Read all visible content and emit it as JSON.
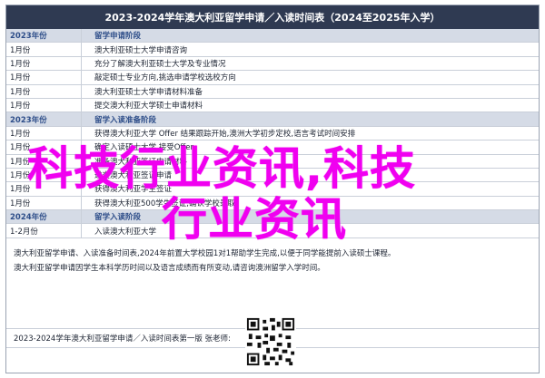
{
  "doc": {
    "title": "2023-2024学年澳大利亚留学申请／入读时间表（2024至2025年入学）"
  },
  "schedule": {
    "rows": [
      {
        "type": "section",
        "month": "2023年份",
        "event": "留学申请阶段"
      },
      {
        "type": "row",
        "month": "1月份",
        "event": "澳大利亚硕士大学申请咨询"
      },
      {
        "type": "row",
        "month": "1月份",
        "event": "充分了解澳大利亚硕士大学及专业情况"
      },
      {
        "type": "row",
        "month": "1月份",
        "event": "敲定硕士专业方向,挑选申请学校选校方向"
      },
      {
        "type": "row",
        "month": "1月份",
        "event": "澳大利亚硕士大学申请材料准备"
      },
      {
        "type": "row",
        "month": "1月份",
        "event": "提交澳大利亚大学硕士申请材料"
      },
      {
        "type": "section",
        "month": "2023年份",
        "event": "留学入读准备阶段"
      },
      {
        "type": "row",
        "month": "1月份",
        "event": "获得澳大利亚大学 Offer 结果跟踪开始,澳洲大学初步定校,语言考试时间安排"
      },
      {
        "type": "row",
        "month": "1月份",
        "event": "确定入读硕士大学,接受Offer"
      },
      {
        "type": "row",
        "month": "1月份",
        "event": "准备澳大利亚签证申请材料"
      },
      {
        "type": "row",
        "month": "1月份",
        "event": "递交澳大利亚签证申请"
      },
      {
        "type": "row",
        "month": "1月份",
        "event": "获得澳大利亚学生签证"
      },
      {
        "type": "row",
        "month": "1月份",
        "event": "获得澳大利亚500学生签证,确认学校录取"
      },
      {
        "type": "section",
        "month": "2024年份",
        "event": "留学入读阶段"
      },
      {
        "type": "row",
        "month": "1-2月份",
        "event": "入读澳大利亚大学"
      }
    ]
  },
  "notes": [
    "澳大利亚留学申请、入读准备时间表,2024年前置大学校园1对1帮助学生完成,以便于同学能提前入读硕士课程。",
    "澳大利亚留学申请因学生本科学历时间以及语言成绩而有所变动,请咨询澳洲留学入学时间。"
  ],
  "footer": {
    "text": "2023-2024学年澳大利亚留学申请／入读时间表第一版 张老师:"
  },
  "overlay": {
    "line1": "科技行业资讯,科技",
    "line2": "行业资讯"
  },
  "colors": {
    "header_bg": "#2f3a52",
    "section_bg": "#d5dbe6",
    "overlay": "#f000f0"
  }
}
